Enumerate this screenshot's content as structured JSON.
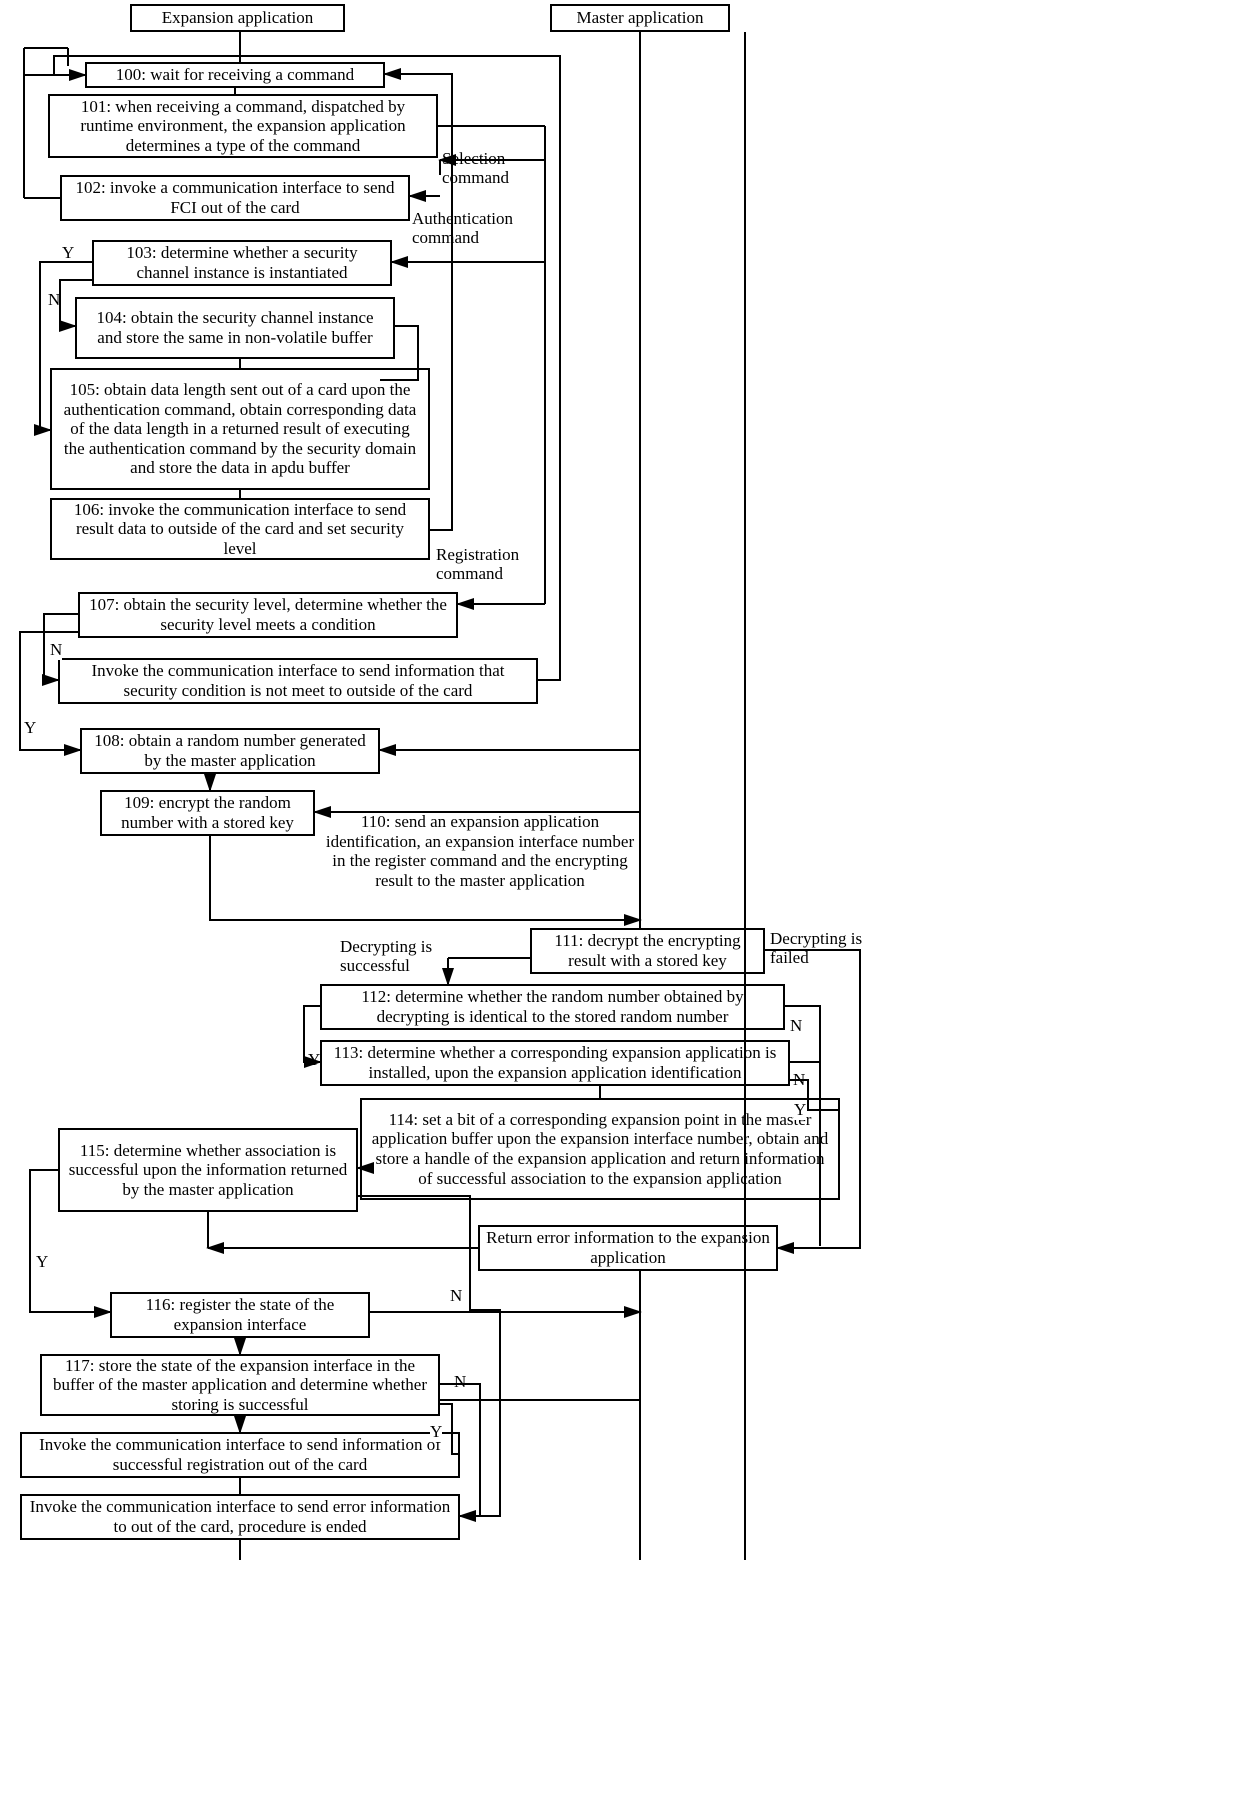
{
  "titles": {
    "expansion": "Expansion application",
    "master": "Master application"
  },
  "nodes": {
    "n100": "100: wait for receiving a command",
    "n101": "101: when receiving a command, dispatched by runtime environment, the expansion application determines a type of the command",
    "n102": "102: invoke a communication interface to send FCI out of the card",
    "n103": "103: determine whether a security channel instance is instantiated",
    "n104": "104: obtain the security channel instance and store the same in non-volatile buffer",
    "n105": "105: obtain data length sent out of a card upon the authentication command, obtain corresponding data of the data length in a returned result of executing the authentication command by the security domain and store the data in apdu buffer",
    "n106": "106: invoke the communication interface to send result data to outside of the card and set security level",
    "n107": "107: obtain the security level, determine whether the security level meets a condition",
    "n107b": "Invoke the communication interface to send information that security condition is not meet to outside of the card",
    "n108": "108: obtain a random number generated by the master application",
    "n109": "109: encrypt the random number with a stored key",
    "n110": "110: send an expansion application identification, an expansion interface number in the register command and the encrypting result  to the master application",
    "n111": "111: decrypt the encrypting result with a stored key",
    "n112": "112: determine whether the random number obtained by decrypting is identical to the stored random number",
    "n113": "113: determine whether a corresponding expansion application is installed, upon the expansion application identification",
    "n114": "114: set a bit of a corresponding expansion point in the master application buffer upon the expansion interface number, obtain and store a handle of the expansion application and return information of successful association to the expansion application",
    "nErr": "Return error information to the expansion application",
    "n115": "115: determine whether association is successful upon the information returned by the master application",
    "n116": "116: register the state of the expansion interface",
    "n117": "117: store the state of the expansion interface in the buffer of the master application and determine whether storing is successful",
    "nSucc": "Invoke the communication interface to send information of successful registration out of the card",
    "nFail": "Invoke the communication interface to send error information to out of the card,  procedure is ended"
  },
  "labels": {
    "selection": "Selection command",
    "authentication": "Authentication command",
    "registration": "Registration command",
    "decryptOk": "Decrypting is successful",
    "decryptFail": "Decrypting is failed",
    "Y": "Y",
    "N": "N"
  }
}
